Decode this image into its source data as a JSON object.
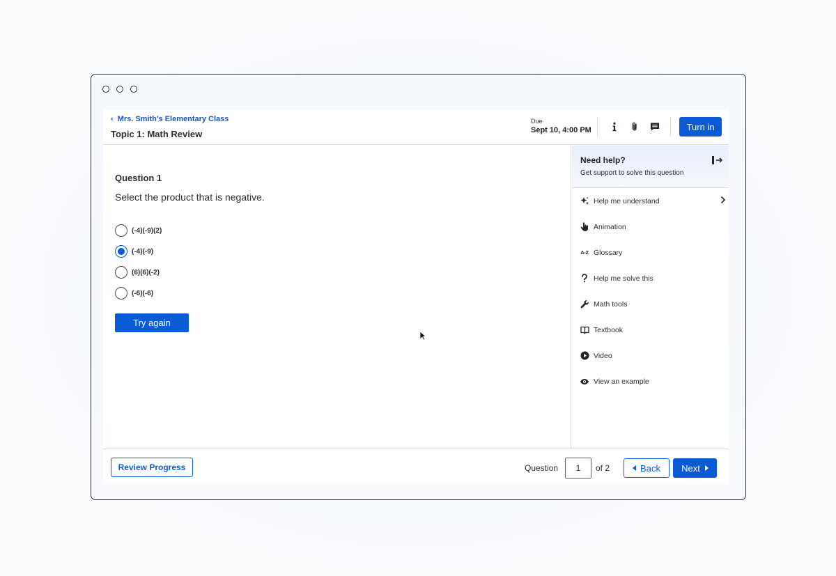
{
  "header": {
    "breadcrumb": "Mrs. Smith's Elementary Class",
    "topic": "Topic 1: Math Review",
    "due_label": "Due",
    "due_value": "Sept 10, 4:00 PM",
    "icons": [
      "info-icon",
      "paperclip-icon",
      "comment-icon"
    ],
    "turn_in_label": "Turn in"
  },
  "question": {
    "title": "Question 1",
    "prompt": "Select the product that is negative.",
    "options": [
      {
        "label": "(-4)(-9)(2)",
        "selected": false
      },
      {
        "label": "(-4)(-9)",
        "selected": true
      },
      {
        "label": "(6)(6)(-2)",
        "selected": false
      },
      {
        "label": "(-6)(-6)",
        "selected": false
      }
    ],
    "try_again_label": "Try again"
  },
  "help": {
    "title": "Need help?",
    "subtitle": "Get support to solve this question",
    "items": [
      {
        "label": "Help me understand",
        "icon": "sparkle-icon"
      },
      {
        "label": "Animation",
        "icon": "hand-pointer-icon"
      },
      {
        "label": "Glossary",
        "icon": "az-icon",
        "icon_text": "A-Z"
      },
      {
        "label": "Help me solve this",
        "icon": "question-icon"
      },
      {
        "label": "Math tools",
        "icon": "wrench-icon"
      },
      {
        "label": "Textbook",
        "icon": "book-icon"
      },
      {
        "label": "Video",
        "icon": "play-icon"
      },
      {
        "label": "View an example",
        "icon": "eye-icon"
      }
    ]
  },
  "footer": {
    "review_label": "Review Progress",
    "question_label": "Question",
    "current_question": "1",
    "of_label": "of 2",
    "back_label": "Back",
    "next_label": "Next"
  },
  "colors": {
    "accent": "#0b5bd7",
    "link": "#1a56b8"
  }
}
